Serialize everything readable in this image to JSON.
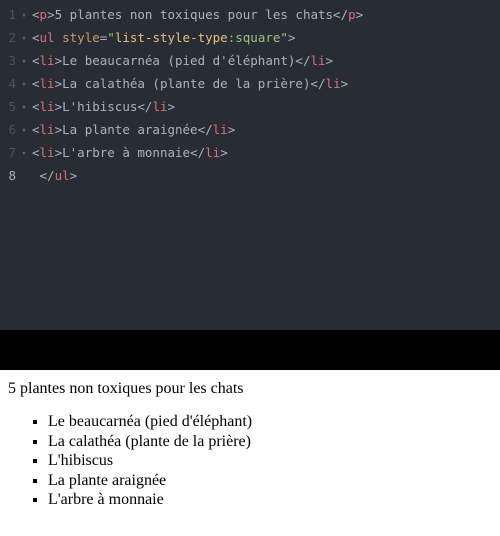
{
  "editor": {
    "lines": [
      {
        "n": "1",
        "fold": "▾",
        "segs": [
          {
            "c": "punct",
            "t": "<"
          },
          {
            "c": "tag",
            "t": "p"
          },
          {
            "c": "punct",
            "t": ">"
          },
          {
            "c": "txt",
            "t": "5 plantes non toxiques pour les chats"
          },
          {
            "c": "punct",
            "t": "</"
          },
          {
            "c": "tag",
            "t": "p"
          },
          {
            "c": "punct",
            "t": ">"
          }
        ]
      },
      {
        "n": "2",
        "fold": "▾",
        "segs": [
          {
            "c": "punct",
            "t": "<"
          },
          {
            "c": "tag",
            "t": "ul"
          },
          {
            "c": "txt",
            "t": " "
          },
          {
            "c": "attr",
            "t": "style"
          },
          {
            "c": "punct",
            "t": "="
          },
          {
            "c": "str",
            "t": "\""
          },
          {
            "c": "strprop",
            "t": "list-style-type"
          },
          {
            "c": "str",
            "t": ":square\""
          },
          {
            "c": "punct",
            "t": ">"
          }
        ]
      },
      {
        "n": "3",
        "fold": "▾",
        "segs": [
          {
            "c": "punct",
            "t": "<"
          },
          {
            "c": "tag",
            "t": "li"
          },
          {
            "c": "punct",
            "t": ">"
          },
          {
            "c": "txt",
            "t": "Le beaucarnéa (pied d'éléphant)"
          },
          {
            "c": "punct",
            "t": "</"
          },
          {
            "c": "tag",
            "t": "li"
          },
          {
            "c": "punct",
            "t": ">"
          }
        ]
      },
      {
        "n": "4",
        "fold": "▾",
        "segs": [
          {
            "c": "punct",
            "t": "<"
          },
          {
            "c": "tag",
            "t": "li"
          },
          {
            "c": "punct",
            "t": ">"
          },
          {
            "c": "txt",
            "t": "La calathéa (plante de la prière)"
          },
          {
            "c": "punct",
            "t": "</"
          },
          {
            "c": "tag",
            "t": "li"
          },
          {
            "c": "punct",
            "t": ">"
          }
        ]
      },
      {
        "n": "5",
        "fold": "▾",
        "segs": [
          {
            "c": "punct",
            "t": "<"
          },
          {
            "c": "tag",
            "t": "li"
          },
          {
            "c": "punct",
            "t": ">"
          },
          {
            "c": "txt",
            "t": "L'hibiscus"
          },
          {
            "c": "punct",
            "t": "</"
          },
          {
            "c": "tag",
            "t": "li"
          },
          {
            "c": "punct",
            "t": ">"
          }
        ]
      },
      {
        "n": "6",
        "fold": "▾",
        "segs": [
          {
            "c": "punct",
            "t": "<"
          },
          {
            "c": "tag",
            "t": "li"
          },
          {
            "c": "punct",
            "t": ">"
          },
          {
            "c": "txt",
            "t": "La plante araignée"
          },
          {
            "c": "punct",
            "t": "</"
          },
          {
            "c": "tag",
            "t": "li"
          },
          {
            "c": "punct",
            "t": ">"
          }
        ]
      },
      {
        "n": "7",
        "fold": "▾",
        "segs": [
          {
            "c": "punct",
            "t": "<"
          },
          {
            "c": "tag",
            "t": "li"
          },
          {
            "c": "punct",
            "t": ">"
          },
          {
            "c": "txt",
            "t": "L'arbre à monnaie"
          },
          {
            "c": "punct",
            "t": "</"
          },
          {
            "c": "tag",
            "t": "li"
          },
          {
            "c": "punct",
            "t": ">"
          }
        ]
      },
      {
        "n": "8",
        "fold": "",
        "active": true,
        "segs": [
          {
            "c": "txt",
            "t": " "
          },
          {
            "c": "punct",
            "t": "</"
          },
          {
            "c": "tag",
            "t": "ul"
          },
          {
            "c": "punct",
            "t": ">"
          }
        ]
      }
    ]
  },
  "preview": {
    "title": "5 plantes non toxiques pour les chats",
    "items": [
      "Le beaucarnéa (pied d'éléphant)",
      "La calathéa (plante de la prière)",
      "L'hibiscus",
      "La plante araignée",
      "L'arbre à monnaie"
    ]
  }
}
